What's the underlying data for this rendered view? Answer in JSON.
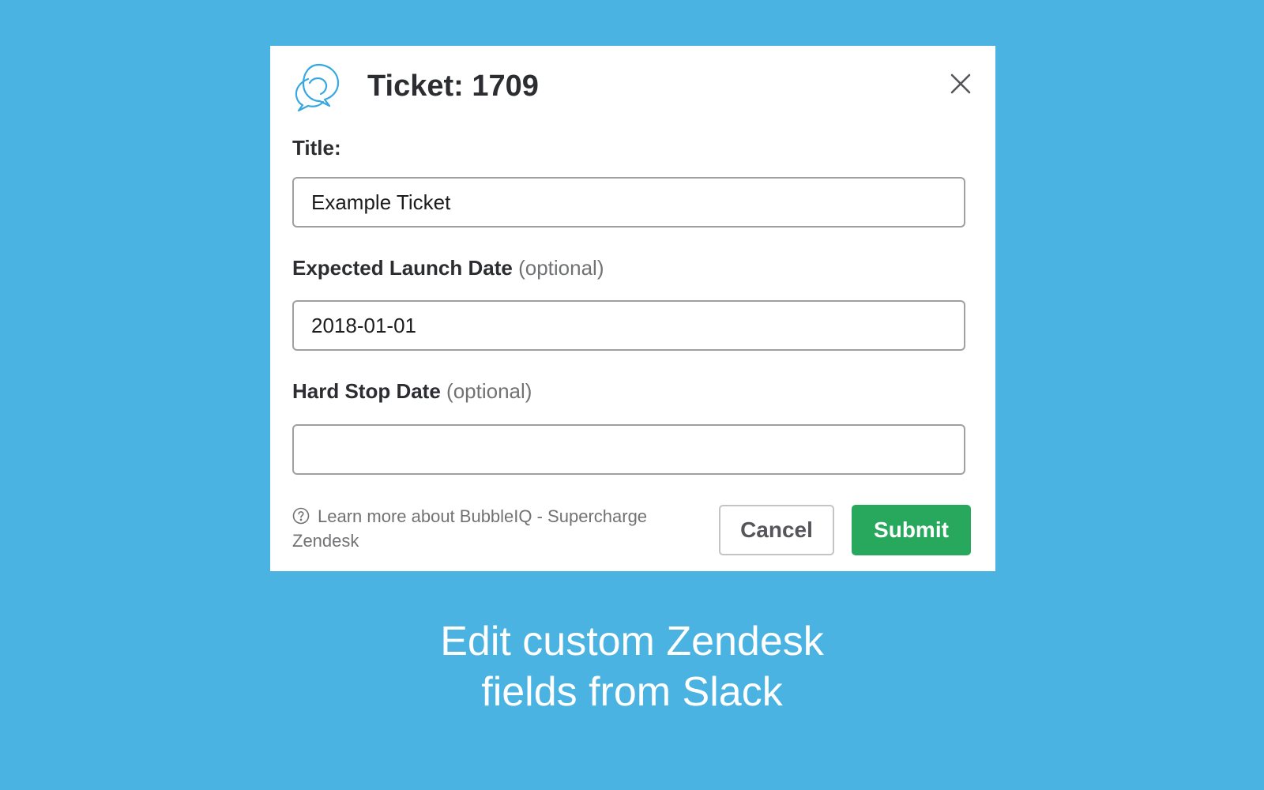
{
  "colors": {
    "background": "#4ab3e2",
    "modal_background": "#ffffff",
    "submit_green": "#27a85c",
    "logo_blue": "#36a9e1",
    "text_dark": "#2c2d30",
    "text_muted": "#717274"
  },
  "modal": {
    "logo_icon": "speech-bubbles-icon",
    "title": "Ticket: 1709",
    "close_icon": "close-icon"
  },
  "fields": [
    {
      "label": "Title:",
      "optional_text": "",
      "value": "Example Ticket",
      "placeholder": ""
    },
    {
      "label": "Expected Launch Date",
      "optional_text": "(optional)",
      "value": "2018-01-01",
      "placeholder": ""
    },
    {
      "label": "Hard Stop Date",
      "optional_text": "(optional)",
      "value": "",
      "placeholder": ""
    }
  ],
  "footer": {
    "help_icon": "question-circle-icon",
    "help_text": "Learn more about BubbleIQ - Supercharge Zendesk",
    "cancel_label": "Cancel",
    "submit_label": "Submit"
  },
  "caption": {
    "line1": "Edit custom Zendesk",
    "line2": "fields from Slack"
  }
}
